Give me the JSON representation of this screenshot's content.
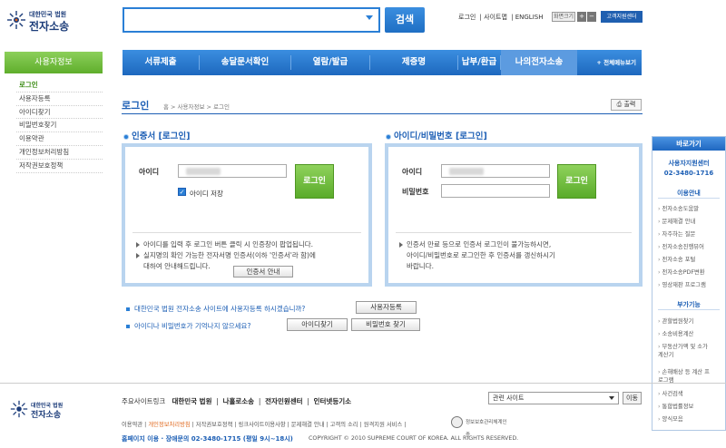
{
  "header": {
    "logo_small": "대한민국 법원",
    "logo_big": "전자소송",
    "search_button": "검색",
    "util_links": [
      "로그인",
      "사이트맵",
      "ENGLISH"
    ],
    "font_size_label": "화면크기",
    "font_plus": "+",
    "font_minus": "−",
    "support_center": "고객지원센터"
  },
  "sidebar": {
    "title": "사용자정보",
    "items": [
      {
        "label": "로그인",
        "active": true
      },
      {
        "label": "사용자등록"
      },
      {
        "label": "아이디찾기"
      },
      {
        "label": "비밀번호찾기"
      },
      {
        "label": "이용약관"
      },
      {
        "label": "개인정보처리방침"
      },
      {
        "label": "저작권보호정책"
      }
    ]
  },
  "nav": {
    "items": [
      "서류제출",
      "송달문서확인",
      "열람/발급",
      "제증명",
      "납부/환급",
      "나의전자소송"
    ],
    "full_menu": "+ 전체메뉴보기"
  },
  "page": {
    "title": "로그인",
    "breadcrumb": "홈 > 사용자정보 > 로그인",
    "print": "출력"
  },
  "cert_panel": {
    "title": "인증서 [로그인]",
    "id_label": "아이디",
    "save_id": "아이디 저장",
    "login_button": "로그인",
    "info1": "아이디를 입력 후 로그인 버튼 클릭 시 인증창이 팝업됩니다.",
    "info2a": "실지명의 확인 가능한 전자서명 인증서(이하 '인증서'라 함)에",
    "info2b": "대하여 안내해드립니다.",
    "guide_button": "인증서 안내"
  },
  "pw_panel": {
    "title": "아이디/비밀번호 [로그인]",
    "id_label": "아이디",
    "pw_label": "비밀번호",
    "login_button": "로그인",
    "info1": "인증서 만료 등으로 인증서 로그인이 불가능하시면,",
    "info2": "아이디/비밀번호로 로그인한 후 인증서를 갱신하시기",
    "info3": "바랍니다."
  },
  "questions": {
    "q1": "대한민국 법원 전자소송 사이트에 사용자등록 하시겠습니까?",
    "q1_button": "사용자등록",
    "q2": "아이디나 비밀번호가 기억나지 않으세요?",
    "q2_button1": "아이디찾기",
    "q2_button2": "비밀번호 찾기"
  },
  "quick": {
    "title": "바로가기",
    "center_name": "사용자지원센터",
    "center_phone": "02-3480-1716",
    "sec1": "이용안내",
    "sec1_items": [
      "전자소송도움말",
      "문제해결 안내",
      "자주하는 질문",
      "전자소송진행뷰어",
      "전자소송 포털",
      "전자소송PDF변환",
      "영상재판 프로그램"
    ],
    "sec2": "부가기능",
    "sec2_items": [
      "관할법원찾기",
      "소송비용계산",
      "부동산가액 및 소가계산기",
      "손해배상 등 계산 프로그램",
      "사건검색",
      "통합법률정보",
      "양식모음"
    ]
  },
  "footer": {
    "logo_small": "대한민국 법원",
    "logo_big": "전자소송",
    "links": [
      "주요사이트링크",
      "대한민국 법원",
      "나홀로소송",
      "전자민원센터",
      "인터넷등기소"
    ],
    "select_label": "관련 사이트",
    "go": "이동",
    "sub_pre": "이용약관 | ",
    "sub_hl": "개인정보처리방침",
    "sub_post": " | 저작권보호정책 | 링크사이트이용사항 | 문제해결 안내 | 고객의 소리 | 원격지원 서비스 |",
    "privacy_badge": "정보보호관리체계인증",
    "phone": "홈페이지 이용 · 장애문의 02-3480-1715 (평일 9시~18시)",
    "copyright": "COPYRIGHT © 2010 SUPREME COURT OF KOREA. ALL RIGHTS RESERVED."
  }
}
